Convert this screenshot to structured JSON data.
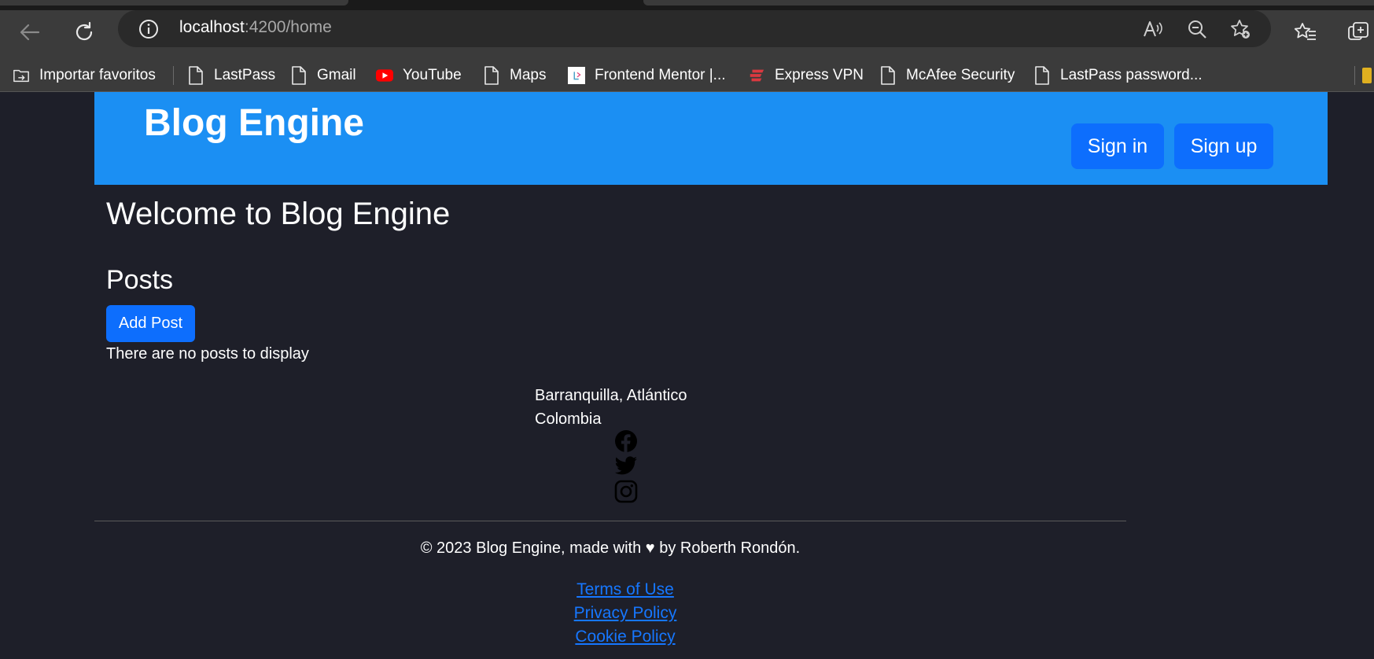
{
  "browser": {
    "url_host": "localhost",
    "url_rest": ":4200/home",
    "bookmarks": [
      {
        "label": "Importar favoritos",
        "icon": "import-folder-icon"
      },
      {
        "label": "LastPass",
        "icon": "page-icon"
      },
      {
        "label": "Gmail",
        "icon": "page-icon"
      },
      {
        "label": "YouTube",
        "icon": "youtube-icon"
      },
      {
        "label": "Maps",
        "icon": "page-icon"
      },
      {
        "label": "Frontend Mentor |...",
        "icon": "frontend-mentor-icon"
      },
      {
        "label": "Express VPN",
        "icon": "expressvpn-icon"
      },
      {
        "label": "McAfee Security",
        "icon": "page-icon"
      },
      {
        "label": "LastPass password...",
        "icon": "page-icon"
      }
    ]
  },
  "header": {
    "brand": "Blog Engine",
    "sign_in": "Sign in",
    "sign_up": "Sign up"
  },
  "main": {
    "welcome": "Welcome to Blog Engine",
    "posts_title": "Posts",
    "add_post": "Add Post",
    "empty_text": "There are no posts to display"
  },
  "footer": {
    "city": "Barranquilla, Atlántico",
    "country": "Colombia",
    "copyright": "© 2023 Blog Engine, made with ♥ by Roberth Rondón.",
    "links": [
      "Terms of Use",
      "Privacy Policy",
      "Cookie Policy"
    ]
  },
  "colors": {
    "header_bg": "#1b8ff3",
    "primary_button": "#0d6efd",
    "page_bg": "#1e1f29",
    "link": "#1677ff"
  }
}
